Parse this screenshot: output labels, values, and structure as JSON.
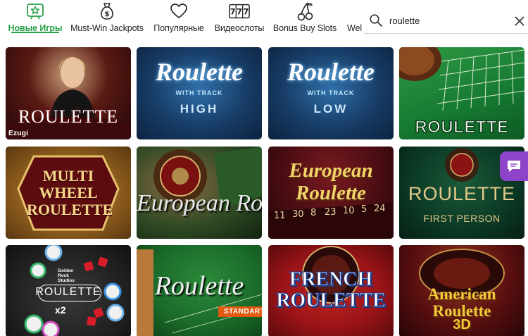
{
  "categories": [
    {
      "label": "Новые Игры",
      "icon": "new-games-star-icon",
      "active": true
    },
    {
      "label": "Must-Win Jackpots",
      "icon": "money-bag-icon"
    },
    {
      "label": "Популярные",
      "icon": "heart-icon"
    },
    {
      "label": "Видеослоты",
      "icon": "slot-reels-icon"
    },
    {
      "label": "Bonus Buy Slots",
      "icon": "cherries-icon"
    },
    {
      "label": "Wel",
      "icon": ""
    }
  ],
  "search": {
    "value": "roulette"
  },
  "games": [
    {
      "title": "ROULETTE",
      "provider": "Ezugi",
      "accent": "#7a0f12"
    },
    {
      "title": "Roulette",
      "subtitle": "WITH TRACK",
      "variant": "HIGH",
      "accent": "#1d4f86"
    },
    {
      "title": "Roulette",
      "subtitle": "WITH TRACK",
      "variant": "LOW",
      "accent": "#1d4f86"
    },
    {
      "title": "ROULETTE",
      "accent": "#167a32"
    },
    {
      "title": "MULTI WHEEL ROULETTE",
      "accent": "#8a5a1c"
    },
    {
      "title": "European Roulette",
      "accent": "#3a6b2c"
    },
    {
      "title": "European Roulette",
      "accent": "#4a0d12"
    },
    {
      "title": "ROULETTE",
      "subtitle": "FIRST PERSON",
      "accent": "#0c3b26"
    },
    {
      "title": "ROULETTE",
      "subtitle": "x2",
      "provider": "Golden Rock Studios",
      "accent": "#202020"
    },
    {
      "title": "Roulette",
      "subtitle": "STANDART",
      "accent": "#1a6b2a"
    },
    {
      "title": "FRENCH ROULETTE",
      "accent": "#9b1418"
    },
    {
      "title": "American Roulette",
      "subtitle": "3D",
      "accent": "#5a0f10"
    }
  ],
  "chat": {
    "icon": "chat-icon"
  }
}
